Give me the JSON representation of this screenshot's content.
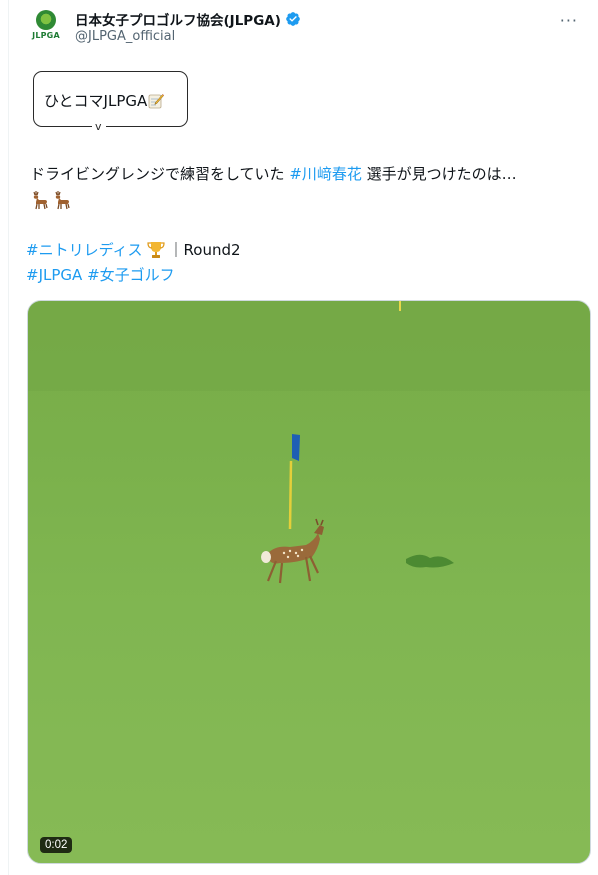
{
  "author": {
    "display_name": "日本女子プロゴルフ協会(JLPGA)",
    "handle": "@JLPGA_official",
    "avatar_label": "JLPGA",
    "verified": true
  },
  "header": {
    "more_label": "···"
  },
  "bubble": {
    "text": "ひとコマJLPGA",
    "icon": "memo-icon",
    "tail_char": "v"
  },
  "post": {
    "text_before": "ドライビングレンジで練習をしていた ",
    "hashtag_player": "#川﨑春花",
    "text_after": " 選手が見つけたのは…",
    "emojis": [
      "deer-icon",
      "deer-icon"
    ]
  },
  "tags": {
    "line1_tag": "#ニトリレディス",
    "line1_icon": "trophy-icon",
    "line1_suffix": "｜Round2",
    "line2_tag_a": "#JLPGA",
    "line2_tag_b": "#女子ゴルフ"
  },
  "media": {
    "type": "video",
    "duration": "0:02"
  },
  "colors": {
    "link": "#1d9bf0",
    "verified": "#1d9bf0",
    "grass": "#80b651",
    "flag": "#1e5fb5"
  }
}
